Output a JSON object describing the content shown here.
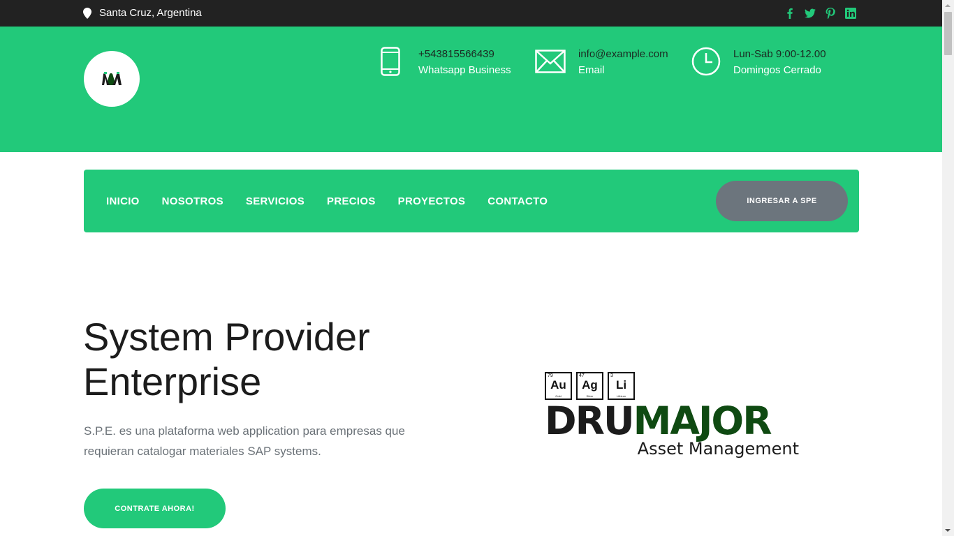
{
  "topbar": {
    "location": "Santa Cruz, Argentina",
    "location_icon": "map-pin-icon",
    "socials": [
      "facebook-icon",
      "twitter-icon",
      "pinterest-icon",
      "linkedin-icon"
    ],
    "social_color": "#22c97a"
  },
  "header": {
    "logo_alt": "logo-icon",
    "contacts": [
      {
        "icon": "phone-icon",
        "line1": "+543815566439",
        "line2": "Whatsapp Business"
      },
      {
        "icon": "envelope-icon",
        "line1": "info@example.com",
        "line2": "Email"
      },
      {
        "icon": "clock-icon",
        "line1": "Lun-Sab 9:00-12.00",
        "line2": "Domingos Cerrado"
      }
    ]
  },
  "nav": {
    "items": [
      "INICIO",
      "NOSOTROS",
      "SERVICIOS",
      "PRECIOS",
      "PROYECTOS",
      "CONTACTO"
    ],
    "cta_label": "INGRESAR A SPE"
  },
  "hero": {
    "title_line1": "System Provider",
    "title_line2": "Enterprise",
    "description": "S.P.E. es una plataforma web application para empresas que requieran catalogar materiales SAP systems.",
    "button_label": "CONTRATE AHORA!"
  },
  "brand": {
    "elements": [
      {
        "number": "79",
        "symbol": "Au",
        "name": "Gold"
      },
      {
        "number": "47",
        "symbol": "Ag",
        "name": "Silver"
      },
      {
        "number": "3",
        "symbol": "Li",
        "name": "Lithium"
      }
    ],
    "word_dark": "DRU",
    "word_green_mark": "M",
    "word_green": "AJOR",
    "subtitle": "Asset Management"
  },
  "colors": {
    "primary": "#22c97a",
    "dark": "#222222",
    "button_gray": "#6c757d"
  }
}
